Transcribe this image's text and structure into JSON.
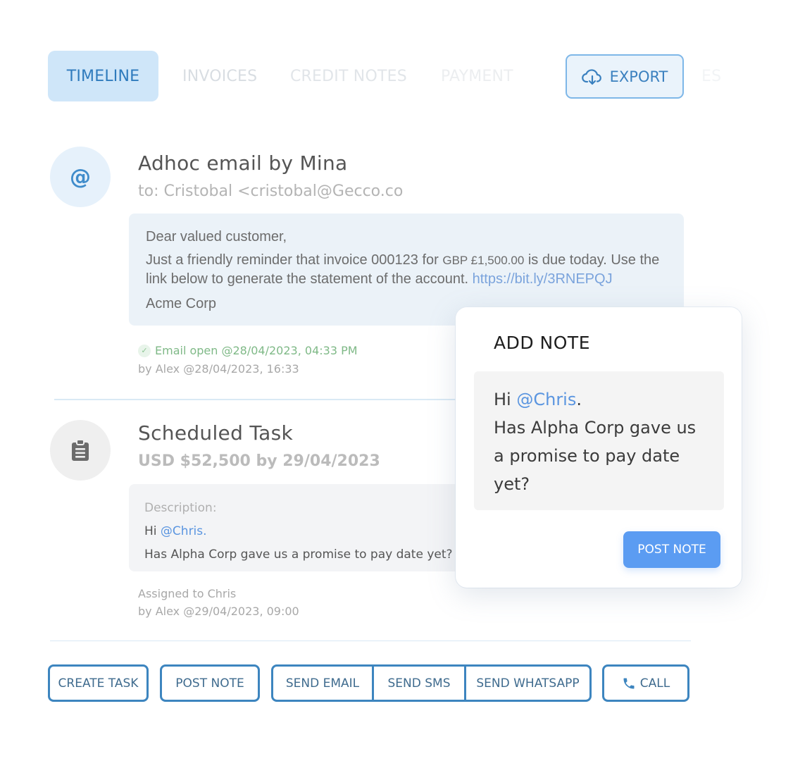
{
  "tabs": [
    {
      "label": "TIMELINE",
      "active": true
    },
    {
      "label": "INVOICES",
      "active": false
    },
    {
      "label": "CREDIT NOTES",
      "active": false
    },
    {
      "label": "PAYMENT",
      "active": false
    },
    {
      "label": "ES",
      "active": false
    }
  ],
  "export": {
    "label": "EXPORT",
    "icon": "cloud-download-icon"
  },
  "email_entry": {
    "icon": "at-sign-icon",
    "icon_glyph": "@",
    "title": "Adhoc email by Mina",
    "to": "to: Cristobal <cristobal@Gecco.co",
    "body": {
      "greeting": "Dear valued customer,",
      "text_before_amount": "Just a friendly reminder that invoice 000123 for ",
      "amount": "GBP £1,500.00",
      "text_after_amount": "  is due today. Use the link below to generate the statement of the account. ",
      "link": "https://bit.ly/3RNEPQJ",
      "signature": "Acme Corp"
    },
    "status": "Email open @28/04/2023, 04:33 PM",
    "byline": "by Alex @28/04/2023, 16:33"
  },
  "task_entry": {
    "icon": "clipboard-icon",
    "title": "Scheduled Task",
    "subtitle": "USD $52,500 by 29/04/2023",
    "description_label": "Description:",
    "greeting": "Hi ",
    "mention": "@Chris.",
    "message": "Has Alpha Corp gave us a promise to pay date yet?",
    "assigned": "Assigned to Chris",
    "byline": "by Alex @29/04/2023, 09:00"
  },
  "add_note": {
    "title": "ADD NOTE",
    "greeting": "Hi ",
    "mention": "@Chris",
    "mention_suffix": ".",
    "message": "Has Alpha Corp gave us a promise to pay date yet?",
    "post_label": "POST NOTE"
  },
  "actions": {
    "create_task": "CREATE TASK",
    "post_note": "POST NOTE",
    "send_email": "SEND EMAIL",
    "send_sms": "SEND SMS",
    "send_whatsapp": "SEND WHATSAPP",
    "call": "CALL"
  },
  "colors": {
    "accent": "#3d85bf",
    "primary_button": "#5b9cf2",
    "tab_active_bg": "#cfe6f9",
    "mention": "#5a95e0",
    "success": "#7fb987"
  }
}
